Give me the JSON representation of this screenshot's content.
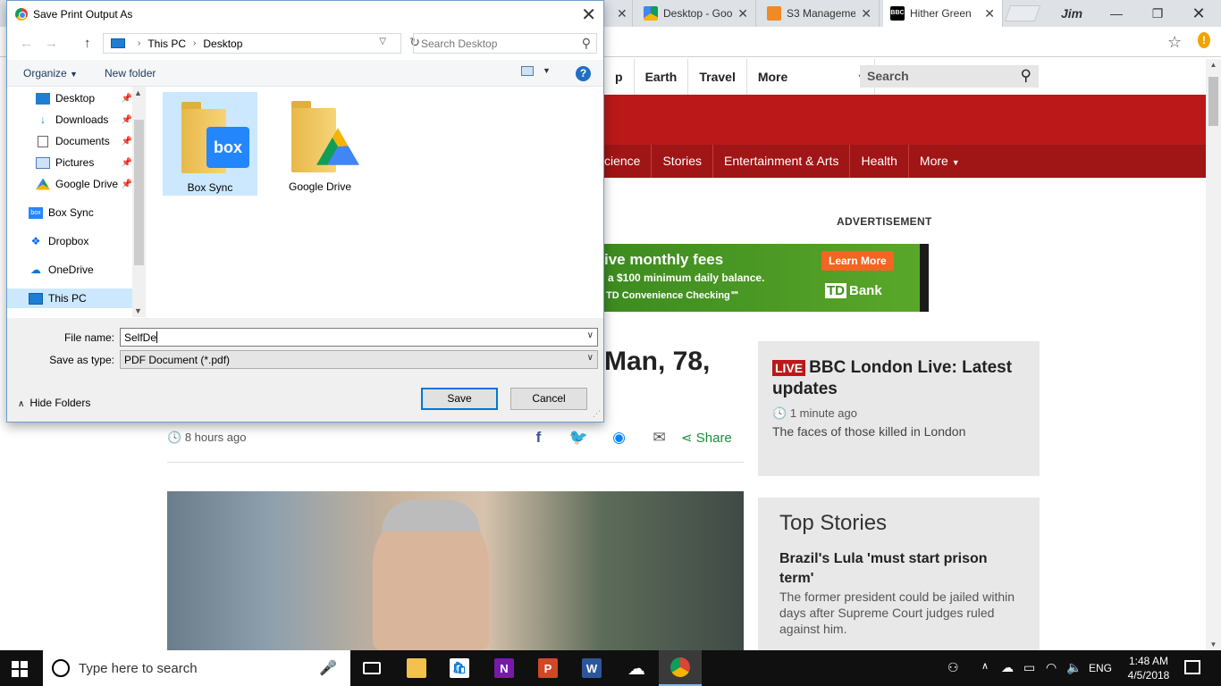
{
  "dialog": {
    "title": "Save Print Output As",
    "breadcrumb": [
      "This PC",
      "Desktop"
    ],
    "search_placeholder": "Search Desktop",
    "toolbar": {
      "organize": "Organize",
      "new_folder": "New folder",
      "help": "?"
    },
    "nav_items": [
      {
        "label": "Desktop",
        "icon": "desktop-icon",
        "pinned": true
      },
      {
        "label": "Downloads",
        "icon": "download-icon",
        "pinned": true
      },
      {
        "label": "Documents",
        "icon": "documents-icon",
        "pinned": true
      },
      {
        "label": "Pictures",
        "icon": "pictures-icon",
        "pinned": true
      },
      {
        "label": "Google Drive",
        "icon": "google-drive-icon",
        "pinned": true
      },
      {
        "label": "Box Sync",
        "icon": "box-icon",
        "pinned": false
      },
      {
        "label": "Dropbox",
        "icon": "dropbox-icon",
        "pinned": false
      },
      {
        "label": "OneDrive",
        "icon": "onedrive-icon",
        "pinned": false
      },
      {
        "label": "This PC",
        "icon": "pc-icon",
        "pinned": false
      }
    ],
    "files": [
      {
        "label": "Box Sync",
        "logo": "box",
        "selected": true
      },
      {
        "label": "Google Drive",
        "logo": "google-drive",
        "selected": false
      }
    ],
    "file_name_label": "File name:",
    "file_name_value": "SelfDe",
    "save_type_label": "Save as type:",
    "save_type_value": "PDF Document (*.pdf)",
    "save_button": "Save",
    "cancel_button": "Cancel",
    "hide_folders": "Hide Folders"
  },
  "browser": {
    "tabs": [
      {
        "label": "Desktop - Goo",
        "icon": "google-drive-icon"
      },
      {
        "label": "S3 Manageme",
        "icon": "aws-icon"
      },
      {
        "label": "Hither Green",
        "icon": "bbc-icon"
      }
    ],
    "profile": "Jim",
    "menu_badge": "!"
  },
  "bbc": {
    "top_nav": [
      "p",
      "Earth",
      "Travel",
      "More"
    ],
    "search": "Search",
    "section_nav": [
      "cience",
      "Stories",
      "Entertainment & Arts",
      "Health",
      "More"
    ],
    "ad_label": "ADVERTISEMENT",
    "ad": {
      "line1": "ive monthly fees",
      "line2": "a $100 minimum daily balance.",
      "line3": "TD Convenience Checking℠",
      "cta": "Learn More",
      "brand": "Bank"
    },
    "headline": "Man, 78,",
    "time": "8 hours ago",
    "share": "Share",
    "live": {
      "badge": "LIVE",
      "title": "BBC London Live: Latest updates",
      "time": "1 minute ago",
      "summary": "The faces of those killed in London"
    },
    "top_stories": {
      "title": "Top Stories",
      "headline": "Brazil's Lula 'must start prison term'",
      "summary": "The former president could be jailed within days after Supreme Court judges ruled against him."
    }
  },
  "taskbar": {
    "search_placeholder": "Type here to search",
    "language": "ENG",
    "time": "1:48 AM",
    "date": "4/5/2018"
  }
}
